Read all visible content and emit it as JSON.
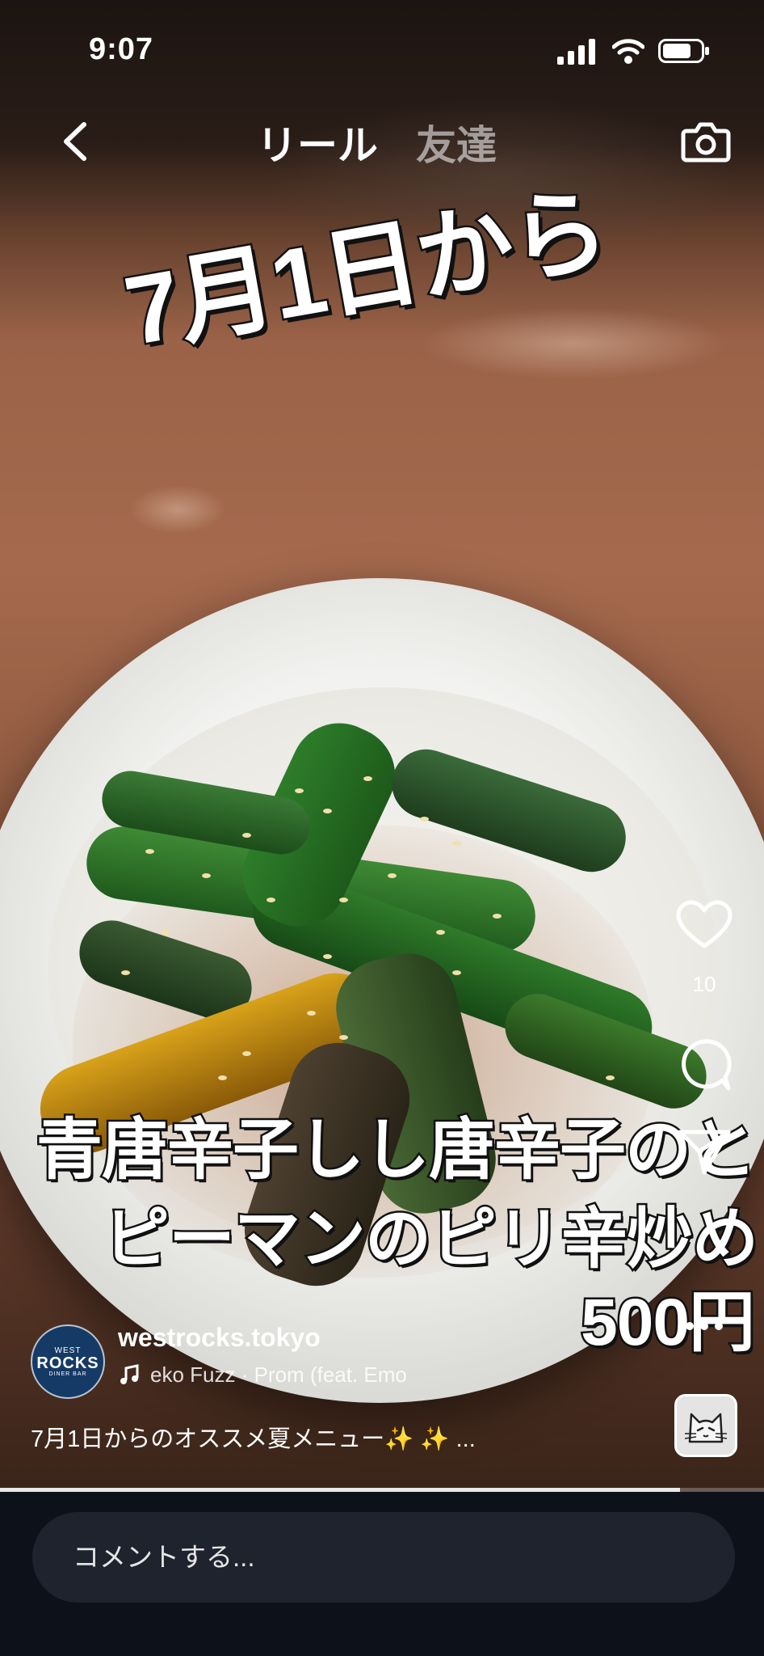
{
  "status_bar": {
    "time": "9:07",
    "icons": [
      "cellular-signal-icon",
      "wifi-icon",
      "battery-icon"
    ]
  },
  "header": {
    "back_icon": "chevron-left-icon",
    "tabs": [
      {
        "label": "リール",
        "active": true
      },
      {
        "label": "友達",
        "active": false
      }
    ],
    "camera_icon": "camera-icon"
  },
  "overlay": {
    "date_text": "7月1日から",
    "dish_line1": "青唐辛子しし唐辛子のと",
    "dish_line2": "ピーマンのピリ辛炒め",
    "price": "500円"
  },
  "actions": {
    "like_icon": "heart-icon",
    "like_count": "10",
    "comment_icon": "comment-bubble-icon",
    "share_icon": "send-icon",
    "more_icon": "more-dots-icon"
  },
  "post": {
    "username": "westrocks.tokyo",
    "avatar_text": {
      "top": "WEST",
      "middle": "ROCKS",
      "bottom": "DINER BAR"
    },
    "audio": "eko Fuzz · Prom (feat. Emo",
    "caption": "7月1日からのオススメ夏メニュー✨ ✨  ..."
  },
  "progress": {
    "fraction": 0.89
  },
  "comment_bar": {
    "placeholder": "コメントする..."
  },
  "colors": {
    "bottom_bar": "#0d1119",
    "input_bg": "#1e232d",
    "avatar_bg": "#153a66"
  }
}
